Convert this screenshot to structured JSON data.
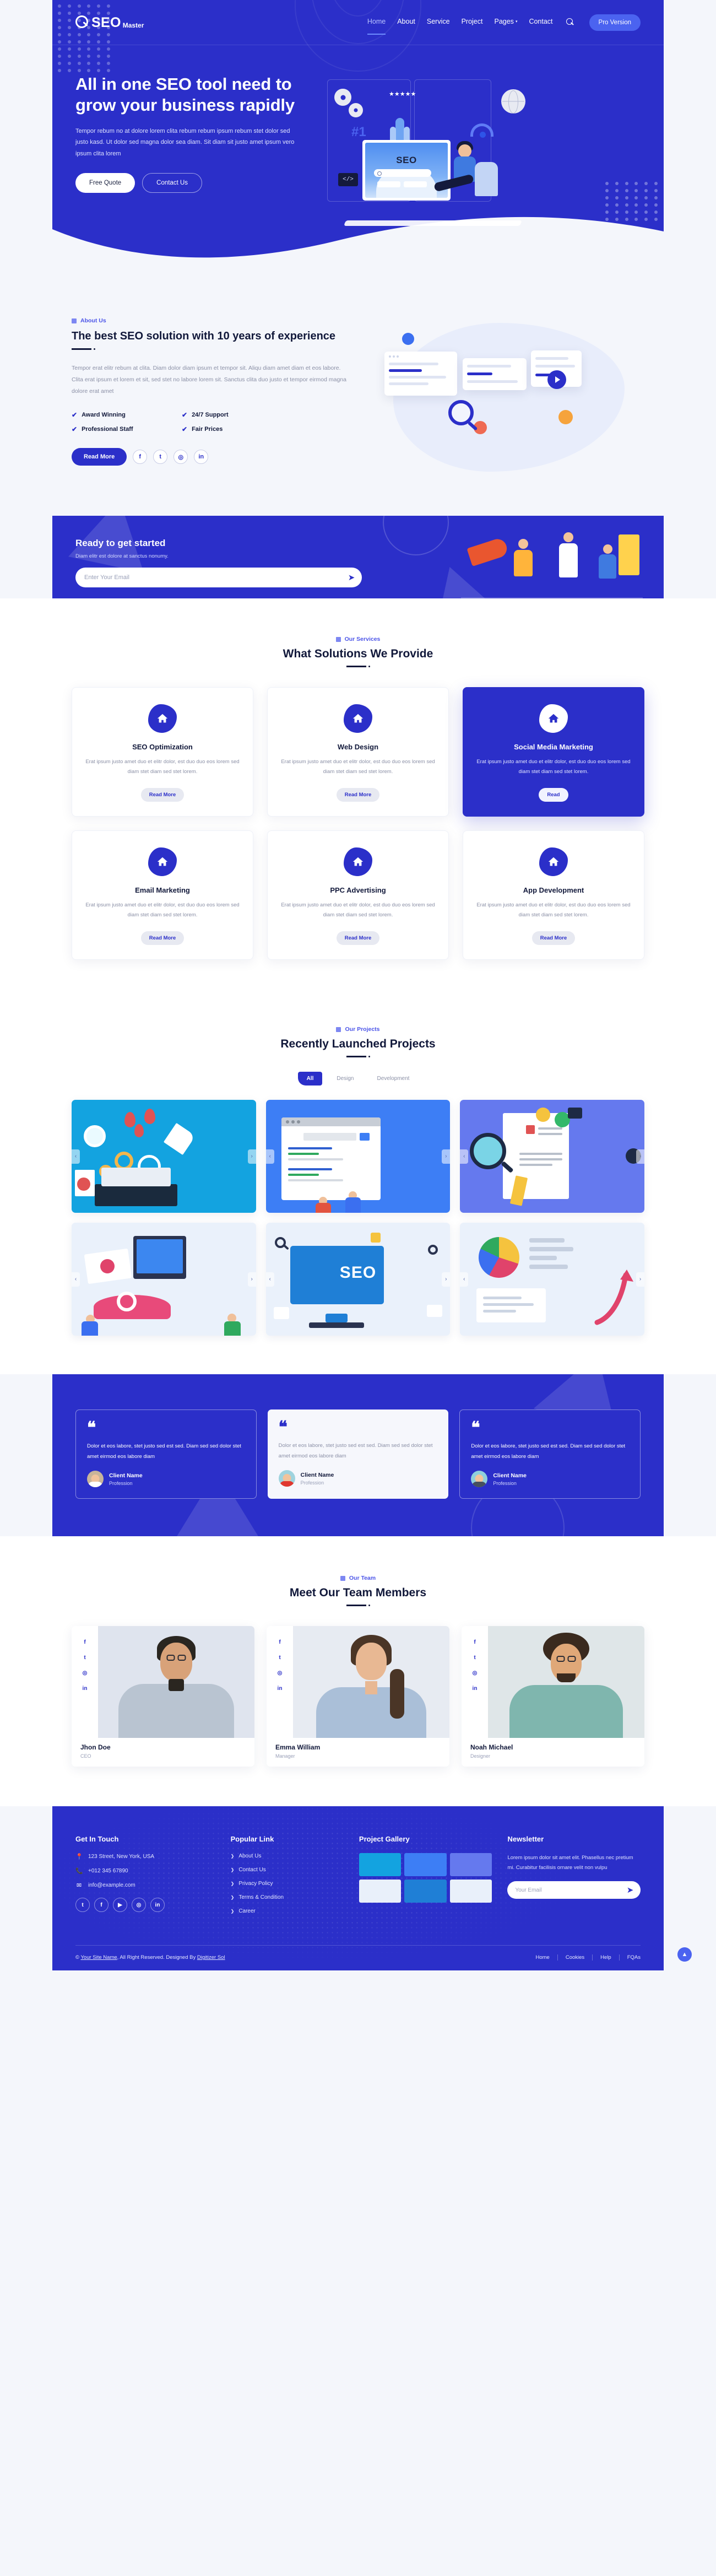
{
  "brand": {
    "name_bold": "SEO",
    "name_light": "Master",
    "logo_icon": "search-magnifier-icon"
  },
  "nav": {
    "items": [
      {
        "label": "Home",
        "active": true
      },
      {
        "label": "About",
        "active": false
      },
      {
        "label": "Service",
        "active": false
      },
      {
        "label": "Project",
        "active": false
      },
      {
        "label": "Pages",
        "active": false,
        "caret": "▾"
      },
      {
        "label": "Contact",
        "active": false
      }
    ],
    "search_icon": "search-icon",
    "pro_button": "Pro Version"
  },
  "hero": {
    "title": "All in one SEO tool need to grow your business rapidly",
    "paragraph": "Tempor rebum no at dolore lorem clita rebum rebum ipsum rebum stet dolor sed justo kasd. Ut dolor sed magna dolor sea diam. Sit diam sit justo amet ipsum vero ipsum clita lorem",
    "primary_button": "Free Quote",
    "secondary_button": "Contact Us",
    "art": {
      "rank_label": "#1",
      "seo_label": "SEO",
      "code_label": "</>",
      "stars": "★★★★★"
    }
  },
  "about": {
    "eyebrow": "About Us",
    "title": "The best SEO solution with 10 years of experience",
    "paragraph": "Tempor erat elitr rebum at clita. Diam dolor diam ipsum et tempor sit. Aliqu diam amet diam et eos labore. Clita erat ipsum et lorem et sit, sed stet no labore lorem sit. Sanctus clita duo justo et tempor eirmod magna dolore erat amet",
    "features": [
      "Award Winning",
      "24/7 Support",
      "Professional Staff",
      "Fair Prices"
    ],
    "read_more": "Read More",
    "socials": [
      "facebook-icon",
      "twitter-icon",
      "instagram-icon",
      "linkedin-icon"
    ],
    "social_glyphs": [
      "f",
      "t",
      "◎",
      "in"
    ]
  },
  "cta": {
    "title": "Ready to get started",
    "subtitle": "Diam elitr est dolore at sanctus nonumy.",
    "email_placeholder": "Enter Your Email",
    "email_value": "",
    "send_icon": "paper-plane-icon"
  },
  "services": {
    "eyebrow": "Our Services",
    "title": "What Solutions We Provide",
    "read_more": "Read More",
    "read_short": "Read",
    "body": "Erat ipsum justo amet duo et elitr dolor, est duo duo eos lorem sed diam stet diam sed stet lorem.",
    "items": [
      {
        "name": "SEO Optimization",
        "icon": "home-icon",
        "highlight": false
      },
      {
        "name": "Web Design",
        "icon": "home-icon",
        "highlight": false
      },
      {
        "name": "Social Media Marketing",
        "icon": "home-icon",
        "highlight": true
      },
      {
        "name": "Email Marketing",
        "icon": "home-icon",
        "highlight": false
      },
      {
        "name": "PPC Advertising",
        "icon": "home-icon",
        "highlight": false
      },
      {
        "name": "App Development",
        "icon": "home-icon",
        "highlight": false
      }
    ]
  },
  "projects": {
    "eyebrow": "Our Projects",
    "title": "Recently Launched Projects",
    "filters": [
      {
        "label": "All",
        "active": true
      },
      {
        "label": "Design",
        "active": false
      },
      {
        "label": "Development",
        "active": false
      }
    ],
    "arrow_left": "‹",
    "arrow_right": "›",
    "items": [
      {
        "theme": "analytics-desk"
      },
      {
        "theme": "search-ranking"
      },
      {
        "theme": "content-research"
      },
      {
        "theme": "mobile-marketing"
      },
      {
        "theme": "seo-screen"
      },
      {
        "theme": "charts-growth"
      }
    ]
  },
  "testimonials": {
    "items": [
      {
        "quote_mark": "❝",
        "text": "Dolor et eos labore, stet justo sed est sed. Diam sed sed dolor stet amet eirmod eos labore diam",
        "name": "Client Name",
        "role": "Profession",
        "style": "blue",
        "avatar": "female-avatar"
      },
      {
        "quote_mark": "❝",
        "text": "Dolor et eos labore, stet justo sed est sed. Diam sed sed dolor stet amet eirmod eos labore diam",
        "name": "Client Name",
        "role": "Profession",
        "style": "white",
        "avatar": "male-avatar"
      },
      {
        "quote_mark": "❝",
        "text": "Dolor et eos labore, stet justo sed est sed. Diam sed sed dolor stet amet eirmod eos labore diam",
        "name": "Client Name",
        "role": "Profession",
        "style": "blue",
        "avatar": "male-avatar"
      }
    ]
  },
  "team": {
    "eyebrow": "Our Team",
    "title": "Meet Our Team Members",
    "social_glyphs": [
      "f",
      "t",
      "◎",
      "in"
    ],
    "members": [
      {
        "name": "Jhon Doe",
        "role": "CEO"
      },
      {
        "name": "Emma William",
        "role": "Manager"
      },
      {
        "name": "Noah Michael",
        "role": "Designer"
      }
    ]
  },
  "footer": {
    "contact": {
      "heading": "Get In Touch",
      "address": "123 Street, New York, USA",
      "phone": "+012 345 67890",
      "email": "info@example.com",
      "address_icon": "location-pin-icon",
      "phone_icon": "phone-icon",
      "email_icon": "envelope-icon",
      "socials": [
        "twitter-icon",
        "facebook-icon",
        "youtube-icon",
        "instagram-icon",
        "linkedin-icon"
      ],
      "social_glyphs": [
        "t",
        "f",
        "▶",
        "◎",
        "in"
      ]
    },
    "links": {
      "heading": "Popular Link",
      "items": [
        "About Us",
        "Contact Us",
        "Privacy Policy",
        "Terms & Condition",
        "Career"
      ],
      "chevron": "❯"
    },
    "gallery": {
      "heading": "Project Gallery",
      "count": 6
    },
    "newsletter": {
      "heading": "Newsletter",
      "paragraph": "Lorem ipsum dolor sit amet elit. Phasellus nec pretium mi. Curabitur facilisis ornare velit non vulpu",
      "email_placeholder": "Your Email",
      "email_value": "",
      "send_icon": "paper-plane-icon"
    },
    "bottom": {
      "copyright_prefix": "© ",
      "site_name": "Your Site Name",
      "copyright_mid": ", All Right Reserved. Designed By ",
      "designer": "Digitizer Sol",
      "menu": [
        "Home",
        "Cookies",
        "Help",
        "FQAs"
      ]
    },
    "back_to_top": "▲"
  },
  "colors": {
    "primary": "#2b2fc9",
    "accent": "#4b63f0",
    "page_bg": "#f4f6fb",
    "text": "#11183a",
    "muted": "#8b90a6"
  }
}
